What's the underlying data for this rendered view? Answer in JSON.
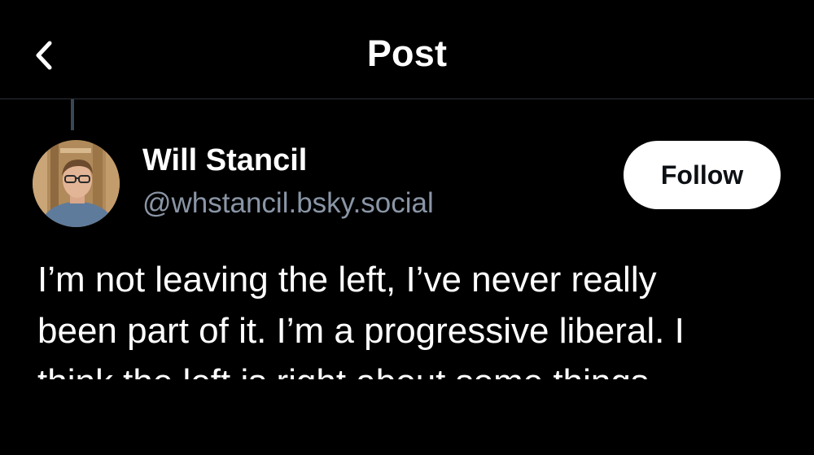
{
  "header": {
    "back_icon": "chevron-left-icon",
    "title": "Post"
  },
  "post": {
    "author": {
      "name": "Will Stancil",
      "handle": "@whstancil.bsky.social"
    },
    "follow_label": "Follow",
    "text_lines": [
      "I’m not leaving the left, I’ve never really",
      "been part of it. I’m a progressive liberal. I",
      "think the left is right about some things"
    ]
  },
  "colors": {
    "background": "#000000",
    "text": "#ffffff",
    "handle": "#8a96a6",
    "divider": "#2a2f36",
    "thread_line": "#3a4756",
    "follow_bg": "#ffffff",
    "follow_text": "#0c1014"
  }
}
